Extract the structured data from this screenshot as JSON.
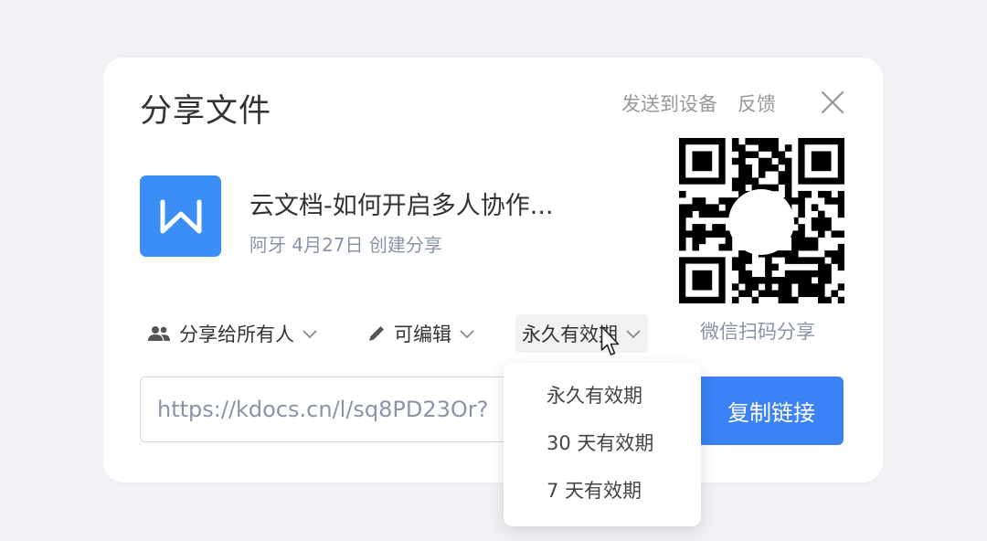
{
  "dialog": {
    "title": "分享文件",
    "send_to_device": "发送到设备",
    "feedback": "反馈"
  },
  "file": {
    "icon_letter": "W",
    "name": "云文档-如何开启多人协作...",
    "meta": "阿牙 4月27日 创建分享"
  },
  "qr": {
    "caption": "微信扫码分享"
  },
  "options": {
    "audience": "分享给所有人",
    "permission": "可编辑",
    "validity": "永久有效期"
  },
  "link": {
    "value": "https://kdocs.cn/l/sq8PD23Or?",
    "copy_label": "复制链接"
  },
  "dropdown": {
    "items": [
      "永久有效期",
      "30 天有效期",
      "7 天有效期"
    ]
  },
  "colors": {
    "accent": "#3b82f6",
    "file_icon": "#3b8ef5"
  }
}
